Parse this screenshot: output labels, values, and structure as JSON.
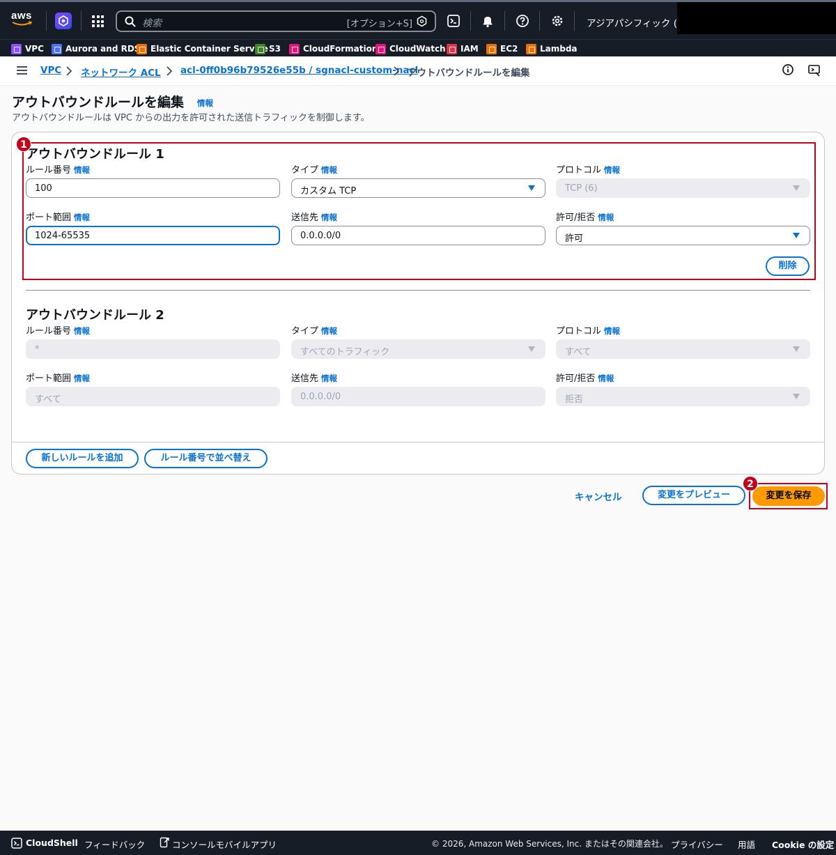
{
  "topnav": {
    "logo_text": "aws",
    "search_placeholder": "検索",
    "search_shortcut": "[オプション+S]",
    "region": "アジアパシフィック (東京)"
  },
  "favorites": [
    {
      "label": "VPC",
      "color": "#8c4fff"
    },
    {
      "label": "Aurora and RDS",
      "color": "#4d72f3"
    },
    {
      "label": "Elastic Container Service",
      "color": "#ed7100"
    },
    {
      "label": "S3",
      "color": "#3f8624"
    },
    {
      "label": "CloudFormation",
      "color": "#e7157b"
    },
    {
      "label": "CloudWatch",
      "color": "#e7157b"
    },
    {
      "label": "IAM",
      "color": "#dd344c"
    },
    {
      "label": "EC2",
      "color": "#ed7100"
    },
    {
      "label": "Lambda",
      "color": "#ed7100"
    }
  ],
  "breadcrumb": {
    "items": [
      "VPC",
      "ネットワーク ACL",
      "acl-0ff0b96b79526e55b / sgnacl-custom-nacl"
    ],
    "current": "アウトバウンドルールを編集"
  },
  "page": {
    "title": "アウトバウンドルールを編集",
    "info": "情報",
    "description": "アウトバウンドルールは VPC からの出力を許可された送信トラフィックを制御します。"
  },
  "labels": {
    "rule_number": "ルール番号",
    "type": "タイプ",
    "protocol": "プロトコル",
    "port_range": "ポート範囲",
    "destination": "送信先",
    "allow_deny": "許可/拒否",
    "info": "情報"
  },
  "rules": [
    {
      "title": "アウトバウンドルール 1",
      "rule_number": "100",
      "type": "カスタム TCP",
      "protocol": "TCP (6)",
      "port_range": "1024-65535",
      "destination": "0.0.0.0/0",
      "allow_deny": "許可",
      "delete_label": "削除"
    },
    {
      "title": "アウトバウンドルール 2",
      "rule_number": "*",
      "type": "すべてのトラフィック",
      "protocol": "すべて",
      "port_range": "すべて",
      "destination": "0.0.0.0/0",
      "allow_deny": "拒否"
    }
  ],
  "panel_buttons": {
    "add_rule": "新しいルールを追加",
    "sort_rules": "ルール番号で並べ替え"
  },
  "actions": {
    "cancel": "キャンセル",
    "preview": "変更をプレビュー",
    "save": "変更を保存"
  },
  "annotations": {
    "badge1": "1",
    "badge2": "2",
    "color": "#c4001a"
  },
  "footer": {
    "cloudshell": "CloudShell",
    "feedback": "フィードバック",
    "mobile_app": "コンソールモバイルアプリ",
    "copyright": "© 2026, Amazon Web Services, Inc. またはその関連会社。",
    "privacy": "プライバシー",
    "terms": "用語",
    "cookie": "Cookie の設定"
  }
}
